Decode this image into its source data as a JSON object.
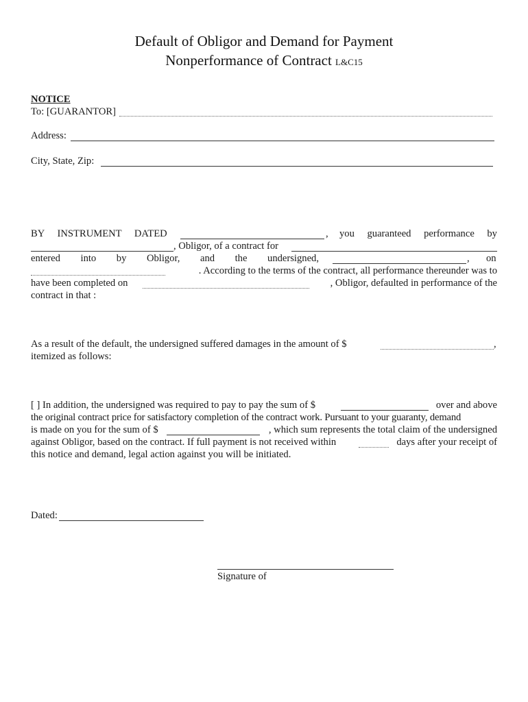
{
  "document": {
    "title_line1": "Default of Obligor and Demand for Payment",
    "title_line2": "Nonperformance of Contract",
    "form_code": "L&C15"
  },
  "notice": {
    "heading": "NOTICE",
    "to_label": "To: [GUARANTOR]",
    "address_label": "Address:",
    "city_label": "City, State, Zip:"
  },
  "paragraph1": {
    "line1": [
      "BY",
      "INSTRUMENT",
      "DATED"
    ],
    "line1_after": ",",
    "line1_words": [
      "you",
      "guaranteed",
      "performance",
      "by"
    ],
    "line2": ", Obligor, of a contract for",
    "line3": [
      "entered",
      "into",
      "by",
      "Obligor,",
      "and",
      "the",
      "undersigned,"
    ],
    "line3_after": ",",
    "line3_end": "on",
    "line4": ".  According to the terms of the contract, all performance thereunder was to",
    "line5_start": "have been completed on",
    "line5_end": ", Obligor, defaulted in performance of the",
    "line6": "contract in that :"
  },
  "paragraph2": {
    "line1": "As a result of the default, the undersigned suffered damages in the amount of $",
    "line1_end": ",",
    "line2": "itemized as follows:"
  },
  "paragraph3": {
    "line1_start": "[ ] In addition, the undersigned was required to pay to pay the sum of $",
    "line1_end": "over and above",
    "line2": "the original contract price for satisfactory completion of the contract work.  Pursuant to your guaranty, demand",
    "line3_start": "is made on you for the sum of $",
    "line3_end": ", which sum represents the total claim of the undersigned",
    "line4_start": "against Obligor, based on the contract.  If full payment is not received within",
    "line4_end": "days after your receipt of",
    "line5": "this notice and demand, legal action against you will be initiated."
  },
  "footer": {
    "dated_label": "Dated:",
    "signature_label": "Signature of"
  }
}
